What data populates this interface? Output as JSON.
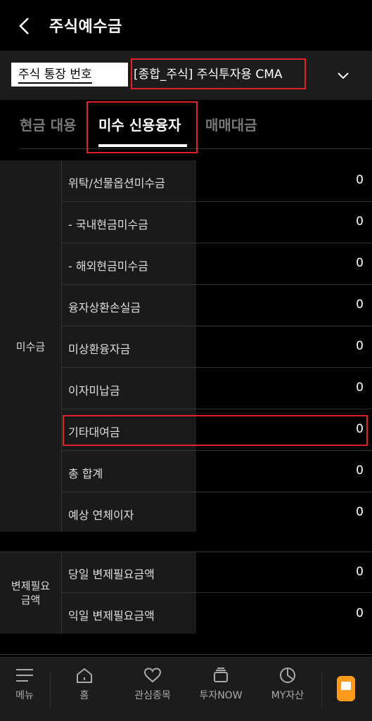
{
  "header": {
    "title": "주식예수금"
  },
  "account": {
    "label": "주식 통장 번호",
    "value": "[종합_주식] 주식투자용 CMA"
  },
  "tabs": [
    "현금 대용",
    "미수 신용융자",
    "매매대금"
  ],
  "groups": [
    {
      "label": "미수금",
      "rows": [
        {
          "label": "위탁/선물옵션미수금",
          "value": "0"
        },
        {
          "label": "- 국내현금미수금",
          "value": "0"
        },
        {
          "label": "- 해외현금미수금",
          "value": "0"
        },
        {
          "label": "융자상환손실금",
          "value": "0"
        },
        {
          "label": "미상환융자금",
          "value": "0"
        },
        {
          "label": "이자미납금",
          "value": "0"
        },
        {
          "label": "기타대여금",
          "value": "0"
        },
        {
          "label": "총 합계",
          "value": "0"
        },
        {
          "label": "예상 연체이자",
          "value": "0"
        }
      ]
    },
    {
      "label": "변제필요금액",
      "label_lines": [
        "변제필요",
        "금액"
      ],
      "rows": [
        {
          "label": "당일 변제필요금액",
          "value": "0"
        },
        {
          "label": "익일 변제필요금액",
          "value": "0"
        }
      ]
    }
  ],
  "nav": [
    {
      "label": "메뉴",
      "icon": "menu-icon"
    },
    {
      "label": "홈",
      "icon": "home-icon"
    },
    {
      "label": "관심종목",
      "icon": "heart-icon"
    },
    {
      "label": "투자NOW",
      "icon": "stack-icon"
    },
    {
      "label": "MY자산",
      "icon": "pie-icon"
    }
  ],
  "colors": {
    "highlight": "#e0202a",
    "fab": "#ff9a1a"
  }
}
